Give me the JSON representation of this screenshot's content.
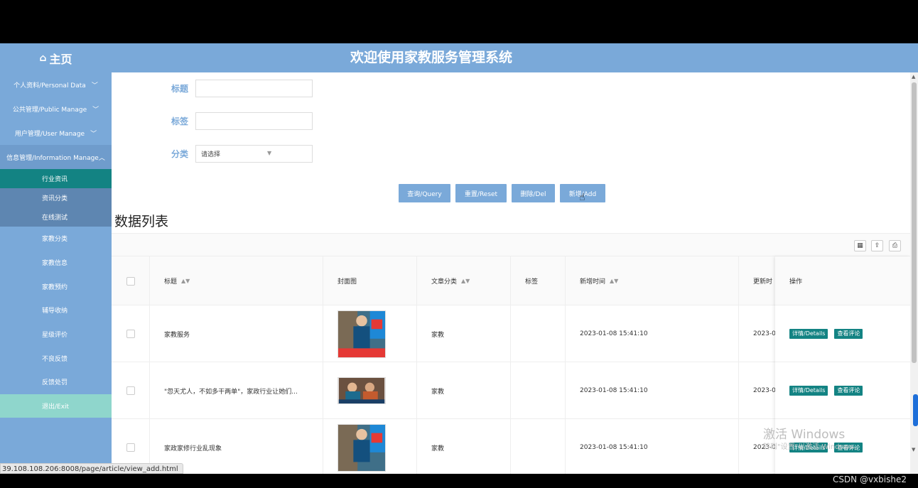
{
  "header": {
    "home_icon": "home-icon",
    "home_label": "主页",
    "system_title": "欢迎使用家教服务管理系统"
  },
  "sidebar": {
    "groups": [
      {
        "label": "个人资料/Personal Data",
        "chevron": "﹀"
      },
      {
        "label": "公共管理/Public Manage",
        "chevron": "﹀"
      },
      {
        "label": "用户管理/User Manage",
        "chevron": "﹀"
      }
    ],
    "open_group": {
      "label": "信息管理/Information Manage",
      "chevron": "︿"
    },
    "sub_items": [
      "行业资讯",
      "资讯分类",
      "在线测试"
    ],
    "flat_items": [
      "家教分类",
      "家教信息",
      "家教预约",
      "辅导收纳",
      "星级评价",
      "不良反馈",
      "反馈处罚"
    ],
    "exit_label": "退出/Exit"
  },
  "status_url": "39.108.108.206:8008/page/article/view_add.html",
  "search": {
    "title_label": "标题",
    "tag_label": "标签",
    "category_label": "分类",
    "category_placeholder": "请选择"
  },
  "buttons": {
    "query": "查询/Query",
    "reset": "重置/Reset",
    "delete": "删除/Del",
    "add": "新增/Add"
  },
  "list": {
    "title": "数据列表",
    "columns": [
      "标题",
      "封面图",
      "文章分类",
      "标签",
      "新增时间",
      "更新时",
      "操作"
    ],
    "rows": [
      {
        "title": "家教服务",
        "category": "家教",
        "tag": "",
        "created": "2023-01-08 15:41:10",
        "updated": "2023-0"
      },
      {
        "title": "\"忽天尤人，不如多干两单\"，家政行业让她们...",
        "category": "家教",
        "tag": "",
        "created": "2023-01-08 15:41:10",
        "updated": "2023-0"
      },
      {
        "title": "家政家修行业乱现象",
        "category": "家教",
        "tag": "",
        "created": "2023-01-08 15:41:10",
        "updated": "2023-0"
      }
    ],
    "actions": {
      "details": "详情/Details",
      "comments": "查看评论"
    }
  },
  "watermark": {
    "line1": "激活 Windows",
    "line2": "转到\"设置\"以激活 Windows。"
  },
  "credit": "CSDN @vxbishe2"
}
